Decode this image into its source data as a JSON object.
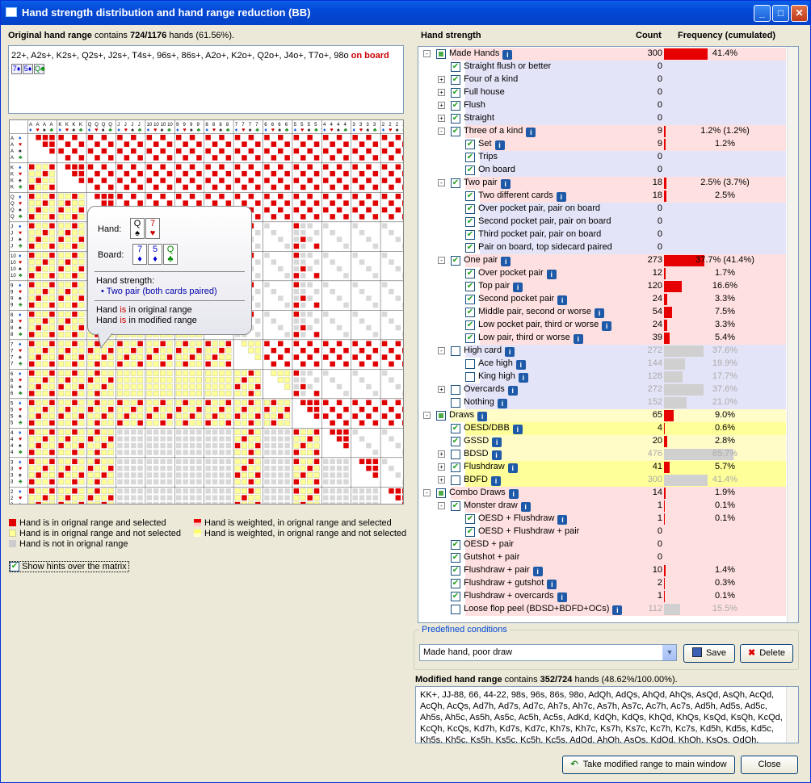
{
  "window": {
    "title": "Hand strength distribution and hand range reduction (BB)"
  },
  "original": {
    "label": "Original hand range",
    "mid": " contains ",
    "count": "724/1176",
    "suffix": " hands (61.56%).",
    "range_text": "22+, A2s+, K2s+, Q2s+, J2s+, T4s+, 96s+, 86s+, A2o+, K2o+, Q2o+, J4o+, T7o+, 98o",
    "on_board": "on board",
    "board_cards": [
      {
        "r": "7",
        "s": "♦",
        "c": "b"
      },
      {
        "r": "5",
        "s": "♦",
        "c": "b"
      },
      {
        "r": "Q",
        "s": "♣",
        "c": "g"
      }
    ]
  },
  "matrix": {
    "ranks": [
      "A",
      "K",
      "Q",
      "J",
      "10",
      "9",
      "8",
      "7",
      "6",
      "5",
      "4",
      "3",
      "2"
    ]
  },
  "tooltip": {
    "hand_label": "Hand:",
    "hand_cards": [
      {
        "r": "Q",
        "s": "♠",
        "c": "k"
      },
      {
        "r": "7",
        "s": "♥",
        "c": "r"
      }
    ],
    "board_label": "Board:",
    "board_cards": [
      {
        "r": "7",
        "s": "♦",
        "c": "b"
      },
      {
        "r": "5",
        "s": "♦",
        "c": "b"
      },
      {
        "r": "Q",
        "s": "♣",
        "c": "g"
      }
    ],
    "strength_label": "Hand strength:",
    "strength_value": "• Two pair (both cards paired)",
    "line1_a": "Hand ",
    "line1_b": "is",
    "line1_c": " in original range",
    "line2_a": "Hand ",
    "line2_b": "is",
    "line2_c": " in modified range"
  },
  "legend": {
    "l1": "Hand is in orignal range and selected",
    "l2": "Hand is in orignal range and not selected",
    "l3": "Hand is not in orignal range",
    "l4": "Hand is weighted, in orignal range and selected",
    "l5": "Hand is weighted, in orignal range and not selected",
    "show_hints": "Show hints over the matrix"
  },
  "tree_header": {
    "strength": "Hand strength",
    "count": "Count",
    "freq": "Frequency (cumulated)"
  },
  "rows": [
    {
      "lvl": 0,
      "exp": "-",
      "cb": "part",
      "name": "Made Hands",
      "info": true,
      "count": "300",
      "freq": "41.4%",
      "pct": 41.4,
      "bg": "r",
      "bar": "r"
    },
    {
      "lvl": 1,
      "exp": "",
      "cb": "on",
      "name": "Straight flush or better",
      "info": false,
      "count": "0",
      "freq": "",
      "pct": 0,
      "bg": "b",
      "bar": "r"
    },
    {
      "lvl": 1,
      "exp": "+",
      "cb": "on",
      "name": "Four of a kind",
      "info": false,
      "count": "0",
      "freq": "",
      "pct": 0,
      "bg": "b",
      "bar": "r"
    },
    {
      "lvl": 1,
      "exp": "+",
      "cb": "on",
      "name": "Full house",
      "info": false,
      "count": "0",
      "freq": "",
      "pct": 0,
      "bg": "b",
      "bar": "r"
    },
    {
      "lvl": 1,
      "exp": "+",
      "cb": "on",
      "name": "Flush",
      "info": false,
      "count": "0",
      "freq": "",
      "pct": 0,
      "bg": "b",
      "bar": "r"
    },
    {
      "lvl": 1,
      "exp": "+",
      "cb": "on",
      "name": "Straight",
      "info": false,
      "count": "0",
      "freq": "",
      "pct": 0,
      "bg": "b",
      "bar": "r"
    },
    {
      "lvl": 1,
      "exp": "-",
      "cb": "on",
      "name": "Three of a kind",
      "info": true,
      "count": "9",
      "freq": "1.2% (1.2%)",
      "pct": 1.2,
      "bg": "r",
      "bar": "r"
    },
    {
      "lvl": 2,
      "exp": "",
      "cb": "on",
      "name": "Set",
      "info": true,
      "count": "9",
      "freq": "1.2%",
      "pct": 1.2,
      "bg": "r",
      "bar": "r"
    },
    {
      "lvl": 2,
      "exp": "",
      "cb": "on",
      "name": "Trips",
      "info": false,
      "count": "0",
      "freq": "",
      "pct": 0,
      "bg": "b",
      "bar": "r"
    },
    {
      "lvl": 2,
      "exp": "",
      "cb": "on",
      "name": "On board",
      "info": false,
      "count": "0",
      "freq": "",
      "pct": 0,
      "bg": "b",
      "bar": "r"
    },
    {
      "lvl": 1,
      "exp": "-",
      "cb": "on",
      "name": "Two pair",
      "info": true,
      "count": "18",
      "freq": "2.5% (3.7%)",
      "pct": 2.5,
      "bg": "r",
      "bar": "r"
    },
    {
      "lvl": 2,
      "exp": "",
      "cb": "on",
      "name": "Two different cards",
      "info": true,
      "count": "18",
      "freq": "2.5%",
      "pct": 2.5,
      "bg": "r",
      "bar": "r"
    },
    {
      "lvl": 2,
      "exp": "",
      "cb": "on",
      "name": "Over pocket pair, pair on board",
      "info": false,
      "count": "0",
      "freq": "",
      "pct": 0,
      "bg": "b",
      "bar": "r"
    },
    {
      "lvl": 2,
      "exp": "",
      "cb": "on",
      "name": "Second pocket pair, pair on board",
      "info": false,
      "count": "0",
      "freq": "",
      "pct": 0,
      "bg": "b",
      "bar": "r"
    },
    {
      "lvl": 2,
      "exp": "",
      "cb": "on",
      "name": "Third pocket pair, pair on board",
      "info": false,
      "count": "0",
      "freq": "",
      "pct": 0,
      "bg": "b",
      "bar": "r"
    },
    {
      "lvl": 2,
      "exp": "",
      "cb": "on",
      "name": "Pair on board, top sidecard paired",
      "info": false,
      "count": "0",
      "freq": "",
      "pct": 0,
      "bg": "b",
      "bar": "r"
    },
    {
      "lvl": 1,
      "exp": "-",
      "cb": "on",
      "name": "One pair",
      "info": true,
      "count": "273",
      "freq": "37.7% (41.4%)",
      "pct": 37.7,
      "bg": "r",
      "bar": "r"
    },
    {
      "lvl": 2,
      "exp": "",
      "cb": "on",
      "name": "Over pocket pair",
      "info": true,
      "count": "12",
      "freq": "1.7%",
      "pct": 1.7,
      "bg": "r",
      "bar": "r"
    },
    {
      "lvl": 2,
      "exp": "",
      "cb": "on",
      "name": "Top pair",
      "info": true,
      "count": "120",
      "freq": "16.6%",
      "pct": 16.6,
      "bg": "r",
      "bar": "r"
    },
    {
      "lvl": 2,
      "exp": "",
      "cb": "on",
      "name": "Second pocket pair",
      "info": true,
      "count": "24",
      "freq": "3.3%",
      "pct": 3.3,
      "bg": "r",
      "bar": "r"
    },
    {
      "lvl": 2,
      "exp": "",
      "cb": "on",
      "name": "Middle pair, second or worse",
      "info": true,
      "count": "54",
      "freq": "7.5%",
      "pct": 7.5,
      "bg": "r",
      "bar": "r"
    },
    {
      "lvl": 2,
      "exp": "",
      "cb": "on",
      "name": "Low pocket pair, third or worse",
      "info": true,
      "count": "24",
      "freq": "3.3%",
      "pct": 3.3,
      "bg": "r",
      "bar": "r"
    },
    {
      "lvl": 2,
      "exp": "",
      "cb": "on",
      "name": "Low pair, third or worse",
      "info": true,
      "count": "39",
      "freq": "5.4%",
      "pct": 5.4,
      "bg": "r",
      "bar": "r"
    },
    {
      "lvl": 1,
      "exp": "-",
      "cb": "off",
      "name": "High card",
      "info": true,
      "count": "272",
      "freq": "37.6%",
      "pct": 37.6,
      "bg": "b",
      "bar": "g",
      "grey": true
    },
    {
      "lvl": 2,
      "exp": "",
      "cb": "off",
      "name": "Ace high",
      "info": true,
      "count": "144",
      "freq": "19.9%",
      "pct": 19.9,
      "bg": "b",
      "bar": "g",
      "grey": true
    },
    {
      "lvl": 2,
      "exp": "",
      "cb": "off",
      "name": "King high",
      "info": true,
      "count": "128",
      "freq": "17.7%",
      "pct": 17.7,
      "bg": "b",
      "bar": "g",
      "grey": true
    },
    {
      "lvl": 1,
      "exp": "+",
      "cb": "off",
      "name": "Overcards",
      "info": true,
      "count": "272",
      "freq": "37.6%",
      "pct": 37.6,
      "bg": "b",
      "bar": "g",
      "grey": true
    },
    {
      "lvl": 1,
      "exp": "",
      "cb": "off",
      "name": "Nothing",
      "info": true,
      "count": "152",
      "freq": "21.0%",
      "pct": 21.0,
      "bg": "b",
      "bar": "g",
      "grey": true
    },
    {
      "lvl": 0,
      "exp": "-",
      "cb": "part",
      "name": "Draws",
      "info": true,
      "count": "65",
      "freq": "9.0%",
      "pct": 9.0,
      "bg": "y",
      "bar": "r"
    },
    {
      "lvl": 1,
      "exp": "",
      "cb": "on",
      "name": "OESD/DBB",
      "info": true,
      "count": "4",
      "freq": "0.6%",
      "pct": 0.6,
      "bg": "Y",
      "bar": "r"
    },
    {
      "lvl": 1,
      "exp": "",
      "cb": "on",
      "name": "GSSD",
      "info": true,
      "count": "20",
      "freq": "2.8%",
      "pct": 2.8,
      "bg": "y",
      "bar": "r"
    },
    {
      "lvl": 1,
      "exp": "+",
      "cb": "off",
      "name": "BDSD",
      "info": true,
      "count": "476",
      "freq": "65.7%",
      "pct": 65.7,
      "bg": "y",
      "bar": "g",
      "grey": true
    },
    {
      "lvl": 1,
      "exp": "+",
      "cb": "on",
      "name": "Flushdraw",
      "info": true,
      "count": "41",
      "freq": "5.7%",
      "pct": 5.7,
      "bg": "Y",
      "bar": "r"
    },
    {
      "lvl": 1,
      "exp": "+",
      "cb": "off",
      "name": "BDFD",
      "info": true,
      "count": "300",
      "freq": "41.4%",
      "pct": 41.4,
      "bg": "Y",
      "bar": "g",
      "grey": true
    },
    {
      "lvl": 0,
      "exp": "-",
      "cb": "part",
      "name": "Combo Draws",
      "info": true,
      "count": "14",
      "freq": "1.9%",
      "pct": 1.9,
      "bg": "p",
      "bar": "r"
    },
    {
      "lvl": 1,
      "exp": "-",
      "cb": "on",
      "name": "Monster draw",
      "info": true,
      "count": "1",
      "freq": "0.1%",
      "pct": 0.1,
      "bg": "p",
      "bar": "r"
    },
    {
      "lvl": 2,
      "exp": "",
      "cb": "on",
      "name": "OESD + Flushdraw",
      "info": true,
      "count": "1",
      "freq": "0.1%",
      "pct": 0.1,
      "bg": "p",
      "bar": "r"
    },
    {
      "lvl": 2,
      "exp": "",
      "cb": "on",
      "name": "OESD + Flushdraw + pair",
      "info": false,
      "count": "0",
      "freq": "",
      "pct": 0,
      "bg": "p",
      "bar": "r"
    },
    {
      "lvl": 1,
      "exp": "",
      "cb": "on",
      "name": "OESD + pair",
      "info": false,
      "count": "0",
      "freq": "",
      "pct": 0,
      "bg": "p",
      "bar": "r"
    },
    {
      "lvl": 1,
      "exp": "",
      "cb": "on",
      "name": "Gutshot + pair",
      "info": false,
      "count": "0",
      "freq": "",
      "pct": 0,
      "bg": "p",
      "bar": "r"
    },
    {
      "lvl": 1,
      "exp": "",
      "cb": "on",
      "name": "Flushdraw + pair",
      "info": true,
      "count": "10",
      "freq": "1.4%",
      "pct": 1.4,
      "bg": "p",
      "bar": "r"
    },
    {
      "lvl": 1,
      "exp": "",
      "cb": "on",
      "name": "Flushdraw + gutshot",
      "info": true,
      "count": "2",
      "freq": "0.3%",
      "pct": 0.3,
      "bg": "p",
      "bar": "r"
    },
    {
      "lvl": 1,
      "exp": "",
      "cb": "on",
      "name": "Flushdraw + overcards",
      "info": true,
      "count": "1",
      "freq": "0.1%",
      "pct": 0.1,
      "bg": "p",
      "bar": "r"
    },
    {
      "lvl": 1,
      "exp": "",
      "cb": "off",
      "name": "Loose flop peel (BDSD+BDFD+OCs)",
      "info": true,
      "count": "112",
      "freq": "15.5%",
      "pct": 15.5,
      "bg": "p",
      "bar": "g",
      "grey": true
    }
  ],
  "predefined": {
    "legend": "Predefined conditions",
    "selected": "Made hand, poor draw",
    "save": "Save",
    "delete": "Delete"
  },
  "modified": {
    "label": "Modified hand range",
    "mid": " contains ",
    "count": "352/724",
    "suffix": " hands (48.62%/100.00%).",
    "text": "KK+, JJ-88, 66, 44-22, 98s, 96s, 86s, 98o, AdQh, AdQs, AhQd, AhQs, AsQd, AsQh, AcQd, AcQh, AcQs, Ad7h, Ad7s, Ad7c, Ah7s, Ah7c, As7h, As7c, Ac7h, Ac7s, Ad5h, Ad5s, Ad5c, Ah5s, Ah5c, As5h, As5c, Ac5h, Ac5s, AdKd, KdQh, KdQs, KhQd, KhQs, KsQd, KsQh, KcQd, KcQh, KcQs, Kd7h, Kd7s, Kd7c, Kh7s, Kh7c, Ks7h, Ks7c, Kc7h, Kc7s, Kd5h, Kd5s, Kd5c, Kh5s, Kh5c, Ks5h, Ks5c, Kc5h, Kc5s, AdQd, AhQh, AsQs, KdQd, KhQh, KsQs, QdQh, QdQs,"
  },
  "buttons": {
    "take": "Take modified range to main window",
    "close": "Close"
  }
}
